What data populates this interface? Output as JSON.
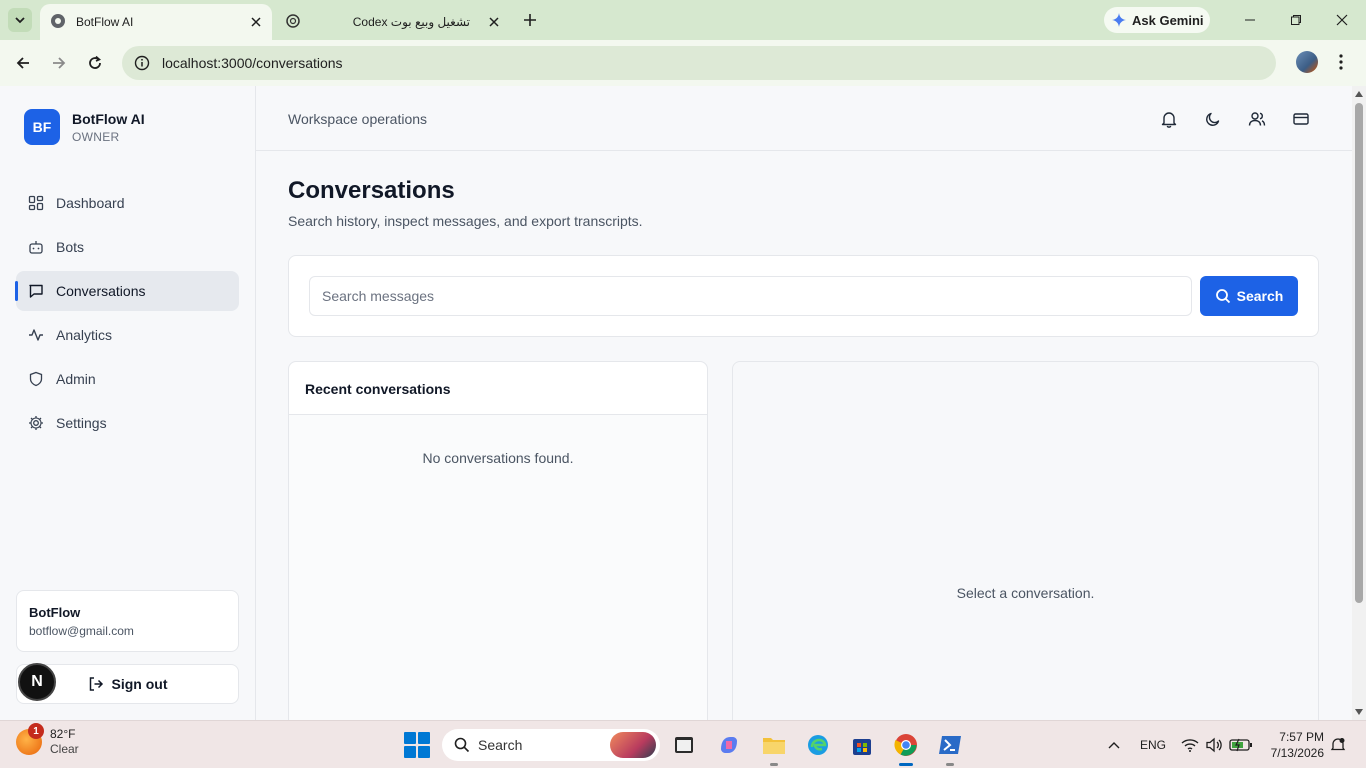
{
  "browser": {
    "tabs": [
      {
        "title": "BotFlow AI",
        "active": true
      },
      {
        "title": "Codex تشغيل وبيع بوت",
        "active": false
      }
    ],
    "ask_gemini": "Ask Gemini",
    "url": "localhost:3000/conversations"
  },
  "sidebar": {
    "brand_initials": "BF",
    "brand_name": "BotFlow AI",
    "role": "OWNER",
    "items": [
      {
        "label": "Dashboard",
        "icon": "grid-icon"
      },
      {
        "label": "Bots",
        "icon": "bot-icon"
      },
      {
        "label": "Conversations",
        "icon": "message-icon",
        "active": true
      },
      {
        "label": "Analytics",
        "icon": "activity-icon"
      },
      {
        "label": "Admin",
        "icon": "shield-icon"
      },
      {
        "label": "Settings",
        "icon": "gear-icon"
      }
    ],
    "user": {
      "name": "BotFlow",
      "email": "botflow@gmail.com"
    },
    "sign_out": "Sign out",
    "badge": "N"
  },
  "topbar": {
    "breadcrumb": "Workspace operations"
  },
  "main": {
    "title": "Conversations",
    "subtitle": "Search history, inspect messages, and export transcripts.",
    "search": {
      "placeholder": "Search messages",
      "value": "",
      "button": "Search"
    },
    "list": {
      "header": "Recent conversations",
      "empty": "No conversations found."
    },
    "detail": {
      "empty": "Select a conversation."
    }
  },
  "taskbar": {
    "weather": {
      "temp": "82°F",
      "condition": "Clear",
      "badge": "1"
    },
    "search_label": "Search",
    "language": "ENG",
    "time": "7:57 PM",
    "date": "7/13/2026"
  },
  "colors": {
    "accent": "#1d62e6",
    "tabstrip": "#d6e8cf"
  }
}
